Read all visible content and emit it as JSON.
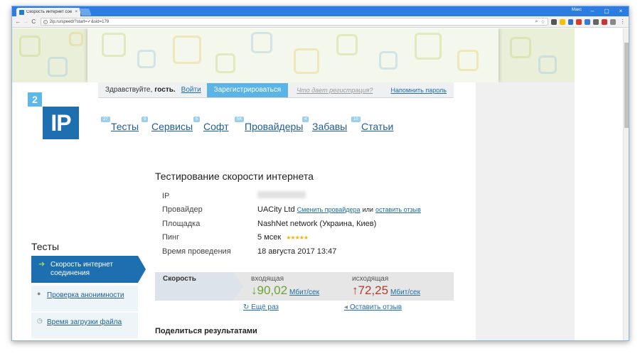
{
  "browser": {
    "tab_title": "Скорость интернет сое",
    "tab_close": "×",
    "user": "Макс",
    "url": "2ip.ru/speed/?start=✓&sid=179",
    "back": "←",
    "forward": "→",
    "reload": "C",
    "min": "–",
    "max": "▢",
    "close": "×"
  },
  "login": {
    "greeting": "Здравствуйте,",
    "guest": "гость.",
    "login": "Войти",
    "register": "Зарегистрироваться",
    "why": "Что дает регистрация?",
    "remind": "Напомнить пароль"
  },
  "logo": {
    "badge": "2",
    "text": "IP"
  },
  "nav": [
    {
      "label": "Тесты",
      "count": "27"
    },
    {
      "label": "Сервисы",
      "count": "9"
    },
    {
      "label": "Софт",
      "count": "5"
    },
    {
      "label": "Провайдеры",
      "count": "5K"
    },
    {
      "label": "Забавы",
      "count": "4"
    },
    {
      "label": "Статьи",
      "count": "10"
    }
  ],
  "main": {
    "title": "Тестирование скорости интернета",
    "rows": {
      "ip_label": "IP",
      "provider_label": "Провайдер",
      "provider_value": "UACity Ltd",
      "change_provider": "Сменить провайдера",
      "or": "или",
      "leave_review": "оставить отзыв",
      "platform_label": "Площадка",
      "platform_value": "NashNet network (Украина, Киев)",
      "ping_label": "Пинг",
      "ping_value": "5 мсек",
      "stars": "★★★★★",
      "time_label": "Время проведения",
      "time_value": "18 августа 2017 13:47"
    },
    "speed": {
      "label": "Скорость",
      "in_title": "входящая",
      "in_value": "↓90,02",
      "out_title": "исходящая",
      "out_value": "↑72,25",
      "unit": "Мбит/сек"
    },
    "again": "Ещё раз",
    "feedback": "Оставить отзыв",
    "share": "Поделиться результатами"
  },
  "sidebar": {
    "title": "Тесты",
    "active": "Скорость интернет соединения",
    "items": [
      "Проверка анонимности",
      "Время загрузки файла"
    ]
  }
}
